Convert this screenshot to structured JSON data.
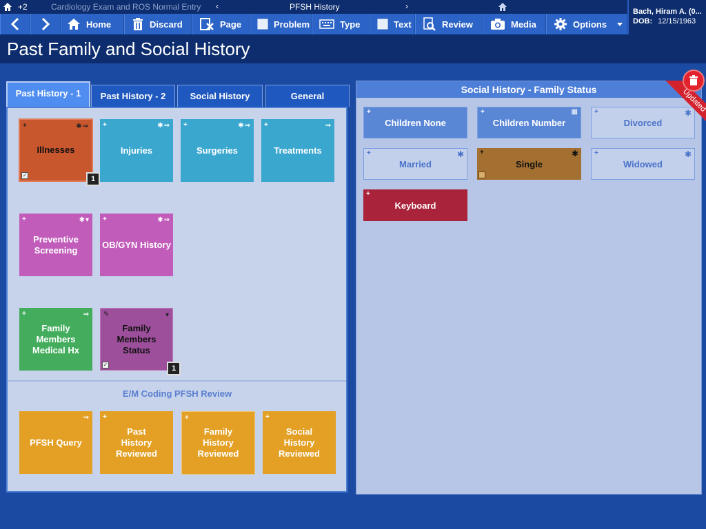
{
  "topbar": {
    "notification_count": "+2",
    "previous_page": "Cardiology Exam and ROS Normal Entry",
    "current_page": "PFSH History",
    "prev_arrow": "‹",
    "next_arrow": "›"
  },
  "patient": {
    "name": "Bach, Hiram A. (0...",
    "dob_label": "DOB:",
    "dob": "12/15/1963"
  },
  "toolbar": {
    "home": "Home",
    "discard": "Discard",
    "page": "Page",
    "problem": "Problem",
    "type": "Type",
    "text": "Text",
    "review": "Review",
    "media": "Media",
    "options": "Options"
  },
  "page_title": "Past Family and Social History",
  "tabs": [
    "Past History - 1",
    "Past History - 2",
    "Social History",
    "General"
  ],
  "tiles": {
    "illnesses": "Illnesses",
    "illnesses_badge": "1",
    "injuries": "Injuries",
    "surgeries": "Surgeries",
    "treatments": "Treatments",
    "preventive_screening": "Preventive Screening",
    "obgyn_history": "OB/GYN History",
    "family_members_medical_hx": "Family Members Medical Hx",
    "family_members_status": "Family Members Status",
    "family_members_status_badge": "1"
  },
  "em_review": {
    "title": "E/M Coding PFSH Review",
    "pfsh_query": "PFSH Query",
    "past_history_reviewed": "Past History Reviewed",
    "family_history_reviewed": "Family History Reviewed",
    "social_history_reviewed": "Social History Reviewed"
  },
  "right_panel": {
    "title": "Social History - Family Status",
    "updated_ribbon": "Updated",
    "options": {
      "children_none": "Children None",
      "children_number": "Children Number",
      "divorced": "Divorced",
      "married": "Married",
      "single": "Single",
      "widowed": "Widowed",
      "keyboard": "Keyboard"
    }
  },
  "colors": {
    "background": "#1b4aa2",
    "toolbar": "#2b63c6",
    "illnesses": "#c9572e",
    "teal": "#3aa7cf",
    "magenta": "#c15cbb",
    "green": "#43ad5d",
    "purple": "#9d4f9b",
    "gold": "#e3a025",
    "keyboard": "#a9233b",
    "single_selected": "#a47032"
  }
}
